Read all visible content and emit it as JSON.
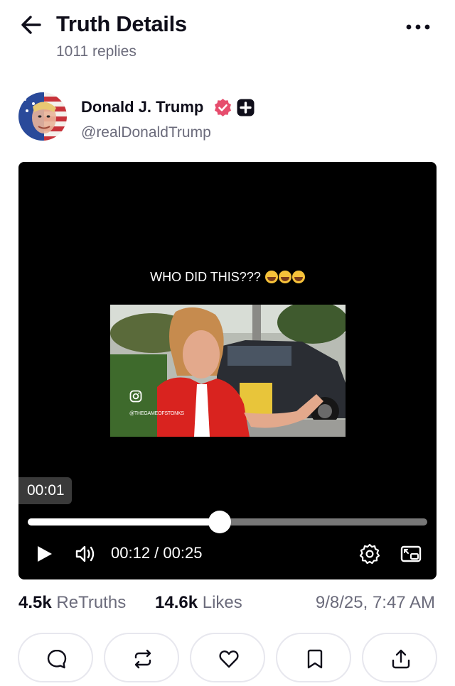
{
  "header": {
    "title": "Truth Details",
    "replies": "1011 replies",
    "icons": [
      "arrow-left-icon",
      "more-horizontal-icon"
    ]
  },
  "author": {
    "name": "Donald J. Trump",
    "handle": "@realDonaldTrump",
    "badges": [
      "verified-badge-icon",
      "plus-badge-icon"
    ],
    "verified_color": "#e64d6d"
  },
  "video": {
    "caption": "WHO DID THIS???",
    "caption_emoji": "laughing-emoji",
    "watermark": "@THEGAMEOFSTONKS",
    "hover_time": "00:01",
    "current_time": "00:12",
    "duration": "00:25",
    "progress": 0.48,
    "icons": [
      "play-icon",
      "volume-icon",
      "gear-icon",
      "picture-in-picture-icon",
      "instagram-icon"
    ]
  },
  "stats": {
    "retruths_count": "4.5k",
    "retruths_label": "ReTruths",
    "likes_count": "14.6k",
    "likes_label": "Likes",
    "date": "9/8/25, 7:47 AM"
  },
  "actions": [
    "reply-icon",
    "retruth-icon",
    "like-icon",
    "bookmark-icon",
    "share-icon"
  ],
  "colors": {
    "text": "#0f0e1a",
    "muted": "#6b6b7b",
    "border": "#e7e7ee",
    "video_bg": "#000000"
  }
}
